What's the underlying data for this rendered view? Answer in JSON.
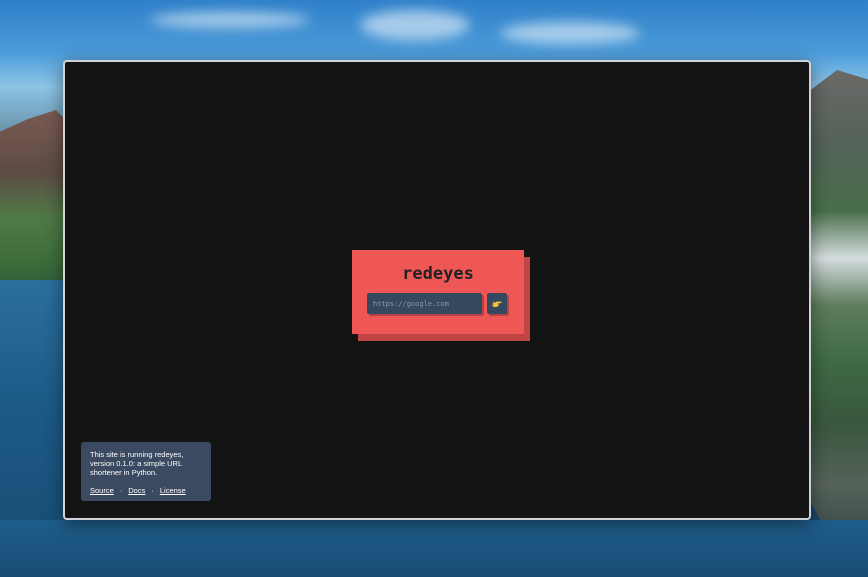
{
  "app": {
    "title": "redeyes",
    "input_placeholder": "https://google.com",
    "submit_icon": "pointing-hand-icon"
  },
  "info": {
    "text": "This site is running redeyes, version 0.1.0: a simple URL shortener in Python.",
    "links": [
      "Source",
      "Docs",
      "License"
    ],
    "separator": "·"
  },
  "colors": {
    "window_background": "#141414",
    "card": "#ef5757",
    "card_shadow": "#c24545",
    "control": "#34495e",
    "info_box": "#3b4a61"
  }
}
